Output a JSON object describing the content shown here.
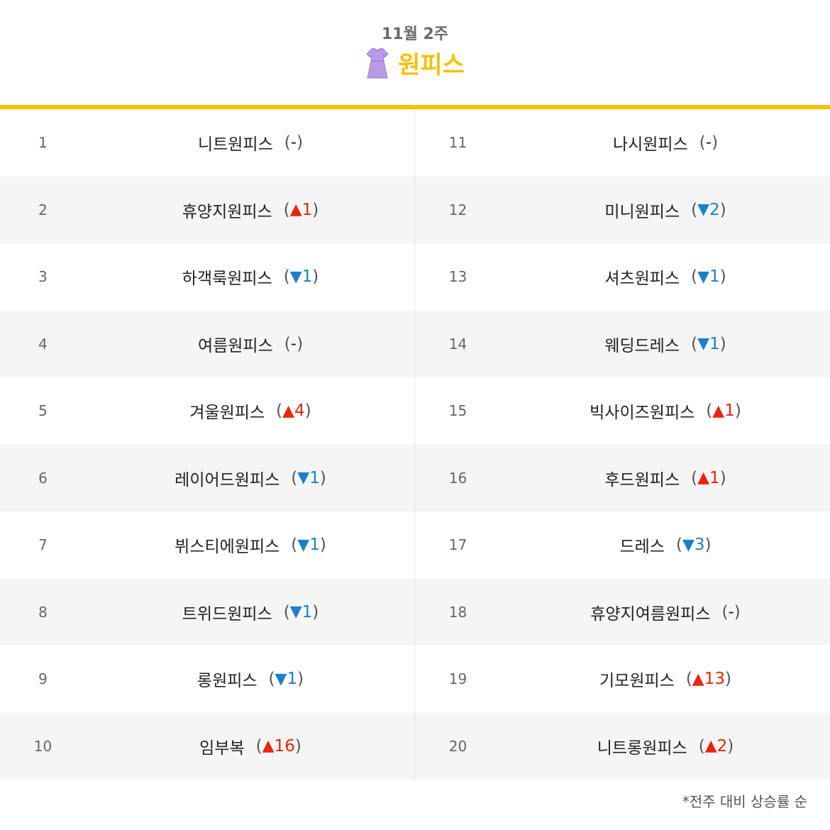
{
  "header": {
    "week": "11월 2주",
    "category": "원피스",
    "icon": "dress-icon",
    "accent_color": "#f2c200",
    "up_color": "#e8250e",
    "down_color": "#1c7fc9"
  },
  "rankings": [
    {
      "rank": "1",
      "name": "니트원피스",
      "dir": "flat",
      "arrow": "",
      "amount": "-"
    },
    {
      "rank": "2",
      "name": "휴양지원피스",
      "dir": "up",
      "arrow": "▲",
      "amount": "1"
    },
    {
      "rank": "3",
      "name": "하객룩원피스",
      "dir": "down",
      "arrow": "▼",
      "amount": "1"
    },
    {
      "rank": "4",
      "name": "여름원피스",
      "dir": "flat",
      "arrow": "",
      "amount": "-"
    },
    {
      "rank": "5",
      "name": "겨울원피스",
      "dir": "up",
      "arrow": "▲",
      "amount": "4"
    },
    {
      "rank": "6",
      "name": "레이어드원피스",
      "dir": "down",
      "arrow": "▼",
      "amount": "1"
    },
    {
      "rank": "7",
      "name": "뷔스티에원피스",
      "dir": "down",
      "arrow": "▼",
      "amount": "1"
    },
    {
      "rank": "8",
      "name": "트위드원피스",
      "dir": "down",
      "arrow": "▼",
      "amount": "1"
    },
    {
      "rank": "9",
      "name": "롱원피스",
      "dir": "down",
      "arrow": "▼",
      "amount": "1"
    },
    {
      "rank": "10",
      "name": "임부복",
      "dir": "up",
      "arrow": "▲",
      "amount": "16"
    },
    {
      "rank": "11",
      "name": "나시원피스",
      "dir": "flat",
      "arrow": "",
      "amount": "-"
    },
    {
      "rank": "12",
      "name": "미니원피스",
      "dir": "down",
      "arrow": "▼",
      "amount": "2"
    },
    {
      "rank": "13",
      "name": "셔츠원피스",
      "dir": "down",
      "arrow": "▼",
      "amount": "1"
    },
    {
      "rank": "14",
      "name": "웨딩드레스",
      "dir": "down",
      "arrow": "▼",
      "amount": "1"
    },
    {
      "rank": "15",
      "name": "빅사이즈원피스",
      "dir": "up",
      "arrow": "▲",
      "amount": "1"
    },
    {
      "rank": "16",
      "name": "후드원피스",
      "dir": "up",
      "arrow": "▲",
      "amount": "1"
    },
    {
      "rank": "17",
      "name": "드레스",
      "dir": "down",
      "arrow": "▼",
      "amount": "3"
    },
    {
      "rank": "18",
      "name": "휴양지여름원피스",
      "dir": "flat",
      "arrow": "",
      "amount": "-"
    },
    {
      "rank": "19",
      "name": "기모원피스",
      "dir": "up",
      "arrow": "▲",
      "amount": "13"
    },
    {
      "rank": "20",
      "name": "니트롱원피스",
      "dir": "up",
      "arrow": "▲",
      "amount": "2"
    }
  ],
  "footnote": "*전주 대비 상승률 순"
}
